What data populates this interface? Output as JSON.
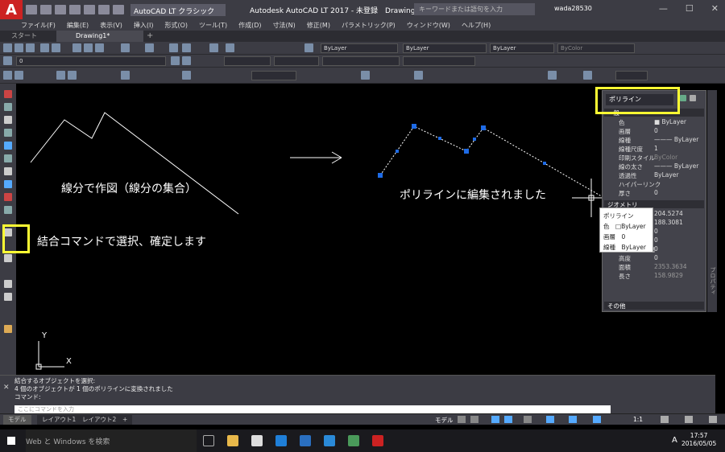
{
  "window": {
    "app_icon": "A",
    "workspace": "AutoCAD LT クラシック",
    "title": "Autodesk AutoCAD LT 2017 - 未登録　Drawing1.dwg",
    "search_placeholder": "キーワードまたは語句を入力",
    "user": "wada28530",
    "min": "—",
    "max": "☐",
    "close": "✕"
  },
  "menu": [
    "ファイル(F)",
    "編集(E)",
    "表示(V)",
    "挿入(I)",
    "形式(O)",
    "ツール(T)",
    "作成(D)",
    "寸法(N)",
    "修正(M)",
    "パラメトリック(P)",
    "ウィンドウ(W)",
    "ヘルプ(H)"
  ],
  "tabs": {
    "start": "スタート",
    "drawing": "Drawing1*",
    "add": "+"
  },
  "toolbars": {
    "layer_value": "0",
    "bylayer1": "ByLayer",
    "bylayer2": "ByLayer",
    "bylayer3": "ByLayer",
    "bycolor": "ByColor"
  },
  "canvas": {
    "text1": "線分で作図（線分の集合）",
    "text2": "ポリラインに編集されました",
    "text3": "結合コマンドで選択、確定します",
    "ucs_x": "X",
    "ucs_y": "Y"
  },
  "palette": {
    "object": "ポリライン",
    "sections": {
      "general": "一般",
      "geometry": "ジオメトリ",
      "misc": "その他"
    },
    "rows": [
      {
        "k": "色",
        "v": "■ ByLayer"
      },
      {
        "k": "画層",
        "v": "0"
      },
      {
        "k": "線種",
        "v": "——— ByLayer"
      },
      {
        "k": "線種尺度",
        "v": "1"
      },
      {
        "k": "印刷スタイル",
        "v": "ByColor"
      },
      {
        "k": "線の太さ",
        "v": "——— ByLayer"
      },
      {
        "k": "透過性",
        "v": "ByLayer"
      },
      {
        "k": "ハイパーリンク",
        "v": ""
      },
      {
        "k": "厚さ",
        "v": "0"
      }
    ],
    "geom": [
      {
        "k": "",
        "v": "204.5274"
      },
      {
        "k": "",
        "v": "188.3081"
      },
      {
        "k": "",
        "v": "0"
      },
      {
        "k": "",
        "v": "0"
      },
      {
        "k": "グローバル幅",
        "v": "0"
      },
      {
        "k": "高度",
        "v": "0"
      },
      {
        "k": "面積",
        "v": "2353.3634"
      },
      {
        "k": "長さ",
        "v": "158.9829"
      }
    ],
    "side_label": "プロパティ"
  },
  "tooltip": {
    "title": "ポリライン",
    "color_label": "色",
    "color_value": "□ByLayer",
    "layer_label": "画層",
    "layer_value": "0",
    "linetype_label": "線種",
    "linetype_value": "ByLayer"
  },
  "command": {
    "line1": "結合するオブジェクトを選択:",
    "line2": "4 個のオブジェクトが 1 個のポリラインに変換されました",
    "line3": "コマンド:",
    "input_placeholder": "ここにコマンドを入力"
  },
  "layout_tabs": [
    "モデル",
    "レイアウト1",
    "レイアウト2",
    "+"
  ],
  "status": {
    "model": "モデル",
    "scale": "1:1"
  },
  "taskbar": {
    "search": "Web と Windows を検索",
    "time": "17:57",
    "date": "2016/05/05",
    "ime": "A"
  }
}
